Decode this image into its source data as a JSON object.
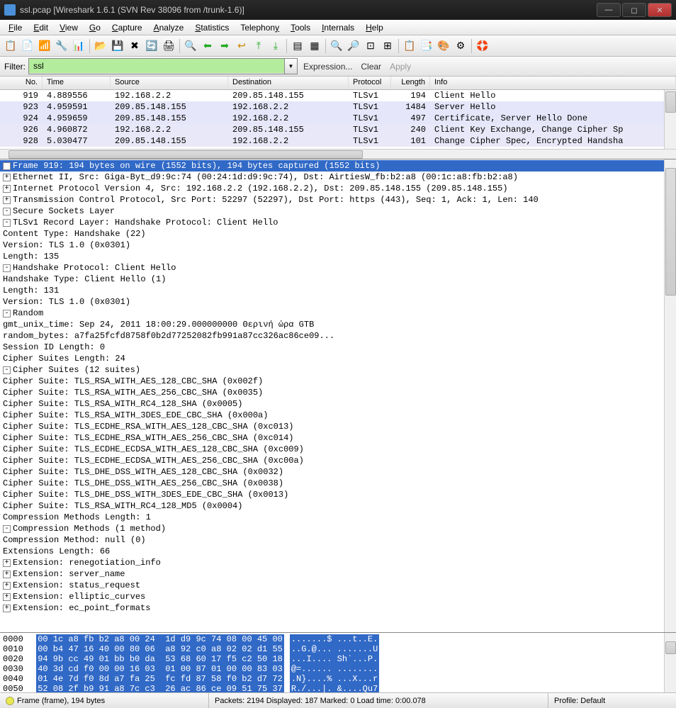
{
  "window": {
    "title": "ssl.pcap   [Wireshark 1.6.1  (SVN Rev 38096 from /trunk-1.6)]"
  },
  "menus": [
    "File",
    "Edit",
    "View",
    "Go",
    "Capture",
    "Analyze",
    "Statistics",
    "Telephony",
    "Tools",
    "Internals",
    "Help"
  ],
  "filter": {
    "label": "Filter:",
    "value": "ssl",
    "expression": "Expression...",
    "clear": "Clear",
    "apply": "Apply"
  },
  "columns": {
    "no": "No.",
    "time": "Time",
    "source": "Source",
    "destination": "Destination",
    "protocol": "Protocol",
    "length": "Length",
    "info": "Info"
  },
  "packets": [
    {
      "no": "919",
      "time": "4.889556",
      "src": "192.168.2.2",
      "dst": "209.85.148.155",
      "proto": "TLSv1",
      "len": "194",
      "info": "Client Hello"
    },
    {
      "no": "923",
      "time": "4.959591",
      "src": "209.85.148.155",
      "dst": "192.168.2.2",
      "proto": "TLSv1",
      "len": "1484",
      "info": "Server Hello"
    },
    {
      "no": "924",
      "time": "4.959659",
      "src": "209.85.148.155",
      "dst": "192.168.2.2",
      "proto": "TLSv1",
      "len": "497",
      "info": "Certificate, Server Hello Done"
    },
    {
      "no": "926",
      "time": "4.960872",
      "src": "192.168.2.2",
      "dst": "209.85.148.155",
      "proto": "TLSv1",
      "len": "240",
      "info": "Client Key Exchange, Change Cipher Sp"
    },
    {
      "no": "928",
      "time": "5.030477",
      "src": "209.85.148.155",
      "dst": "192.168.2.2",
      "proto": "TLSv1",
      "len": "101",
      "info": "Change Cipher Spec, Encrypted Handsha"
    }
  ],
  "details": {
    "frame": "Frame 919: 194 bytes on wire (1552 bits), 194 bytes captured (1552 bits)",
    "eth": "Ethernet II, Src: Giga-Byt_d9:9c:74 (00:24:1d:d9:9c:74), Dst: AirtiesW_fb:b2:a8 (00:1c:a8:fb:b2:a8)",
    "ip": "Internet Protocol Version 4, Src: 192.168.2.2 (192.168.2.2), Dst: 209.85.148.155 (209.85.148.155)",
    "tcp": "Transmission Control Protocol, Src Port: 52297 (52297), Dst Port: https (443), Seq: 1, Ack: 1, Len: 140",
    "ssl": "Secure Sockets Layer",
    "record": "TLSv1 Record Layer: Handshake Protocol: Client Hello",
    "content_type": "Content Type: Handshake (22)",
    "version_rec": "Version: TLS 1.0 (0x0301)",
    "length_rec": "Length: 135",
    "handshake_proto": "Handshake Protocol: Client Hello",
    "hs_type": "Handshake Type: Client Hello (1)",
    "hs_len": "Length: 131",
    "hs_ver": "Version: TLS 1.0 (0x0301)",
    "random": "Random",
    "gmt": "gmt_unix_time: Sep 24, 2011 18:00:29.000000000 Θερινή ώρα GTB",
    "random_bytes": "random_bytes: a7fa25fcfd8758f0b2d77252082fb991a87cc326ac86ce09...",
    "session_len": "Session ID Length: 0",
    "cipher_len": "Cipher Suites Length: 24",
    "cipher_suites": "Cipher Suites (12 suites)",
    "cs": [
      "Cipher Suite: TLS_RSA_WITH_AES_128_CBC_SHA (0x002f)",
      "Cipher Suite: TLS_RSA_WITH_AES_256_CBC_SHA (0x0035)",
      "Cipher Suite: TLS_RSA_WITH_RC4_128_SHA (0x0005)",
      "Cipher Suite: TLS_RSA_WITH_3DES_EDE_CBC_SHA (0x000a)",
      "Cipher Suite: TLS_ECDHE_RSA_WITH_AES_128_CBC_SHA (0xc013)",
      "Cipher Suite: TLS_ECDHE_RSA_WITH_AES_256_CBC_SHA (0xc014)",
      "Cipher Suite: TLS_ECDHE_ECDSA_WITH_AES_128_CBC_SHA (0xc009)",
      "Cipher Suite: TLS_ECDHE_ECDSA_WITH_AES_256_CBC_SHA (0xc00a)",
      "Cipher Suite: TLS_DHE_DSS_WITH_AES_128_CBC_SHA (0x0032)",
      "Cipher Suite: TLS_DHE_DSS_WITH_AES_256_CBC_SHA (0x0038)",
      "Cipher Suite: TLS_DHE_DSS_WITH_3DES_EDE_CBC_SHA (0x0013)",
      "Cipher Suite: TLS_RSA_WITH_RC4_128_MD5 (0x0004)"
    ],
    "comp_len": "Compression Methods Length: 1",
    "comp_methods": "Compression Methods (1 method)",
    "comp_null": "Compression Method: null (0)",
    "ext_len": "Extensions Length: 66",
    "ext": [
      "Extension: renegotiation_info",
      "Extension: server_name",
      "Extension: status_request",
      "Extension: elliptic_curves",
      "Extension: ec_point_formats"
    ]
  },
  "hex": [
    {
      "off": "0000",
      "bytes": "00 1c a8 fb b2 a8 00 24  1d d9 9c 74 08 00 45 00",
      "ascii": ".......$ ...t..E."
    },
    {
      "off": "0010",
      "bytes": "00 b4 47 16 40 00 80 06  a8 92 c0 a8 02 02 d1 55",
      "ascii": "..G.@... .......U"
    },
    {
      "off": "0020",
      "bytes": "94 9b cc 49 01 bb b0 da  53 68 60 17 f5 c2 50 18",
      "ascii": "...I.... Sh`...P."
    },
    {
      "off": "0030",
      "bytes": "40 3d cd f0 00 00 16 03  01 00 87 01 00 00 83 03",
      "ascii": "@=...... ........"
    },
    {
      "off": "0040",
      "bytes": "01 4e 7d f0 8d a7 fa 25  fc fd 87 58 f0 b2 d7 72",
      "ascii": ".N}....% ...X...r"
    },
    {
      "off": "0050",
      "bytes": "52 08 2f b9 91 a8 7c c3  26 ac 86 ce 09 51 75 37",
      "ascii": "R./...|. &....Qu7"
    }
  ],
  "status": {
    "field": "Frame (frame), 194 bytes",
    "packets": "Packets: 2194 Displayed: 187 Marked: 0 Load time: 0:00.078",
    "profile": "Profile: Default"
  },
  "toolbar_icons": [
    "list",
    "save",
    "printer",
    "ifaces",
    "start",
    "folder",
    "disk",
    "close",
    "reload",
    "print",
    "search",
    "back",
    "fwd",
    "jump",
    "up",
    "down",
    "display1",
    "display2",
    "zoom-in",
    "zoom-out",
    "zoom-reset",
    "columns",
    "capture-filter",
    "display-filter",
    "coloring",
    "prefs",
    "help"
  ]
}
